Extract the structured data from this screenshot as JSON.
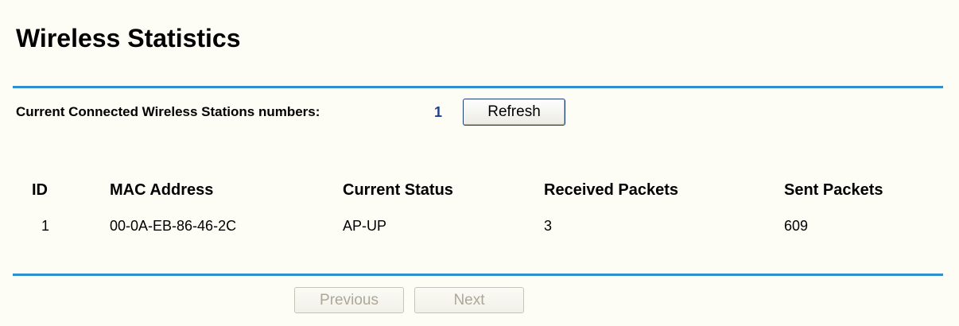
{
  "page": {
    "title": "Wireless Statistics"
  },
  "stations": {
    "count_label": "Current Connected Wireless Stations numbers:",
    "count_value": "1",
    "refresh_label": "Refresh"
  },
  "table": {
    "headers": {
      "id": "ID",
      "mac": "MAC Address",
      "status": "Current Status",
      "received": "Received Packets",
      "sent": "Sent Packets"
    },
    "rows": [
      {
        "id": "1",
        "mac": "00-0A-EB-86-46-2C",
        "status": "AP-UP",
        "received": "3",
        "sent": "609"
      }
    ]
  },
  "pagination": {
    "previous_label": "Previous",
    "next_label": "Next"
  },
  "colors": {
    "background": "#fdfdf5",
    "rule": "#2f8fcf",
    "count_value": "#1f3f8f",
    "disabled_text": "#aca899"
  }
}
